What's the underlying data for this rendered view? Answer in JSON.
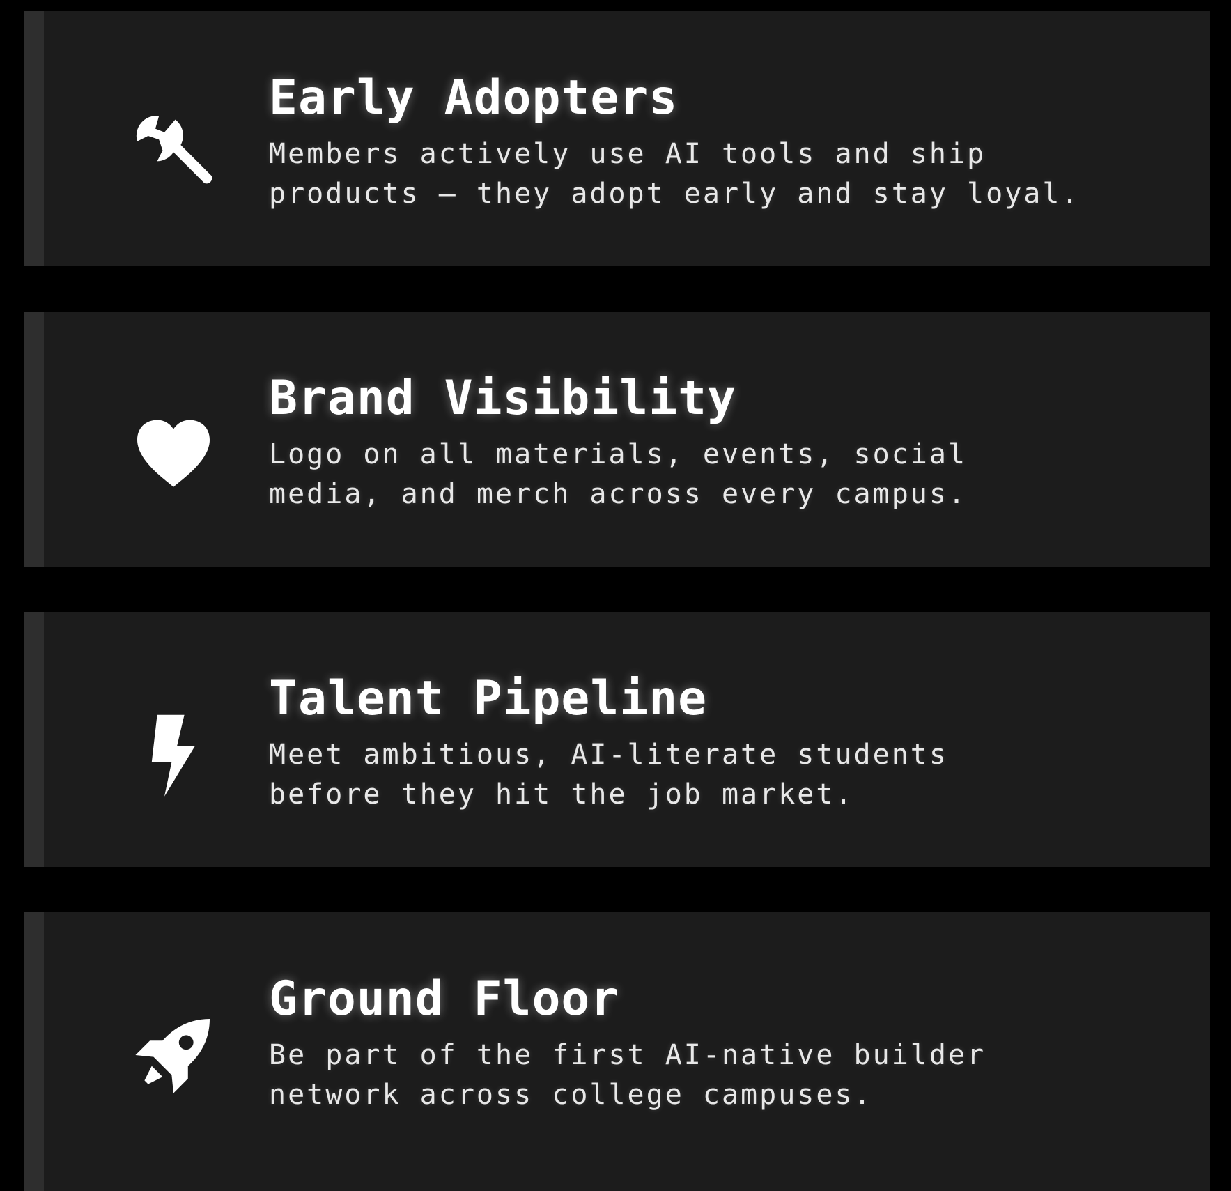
{
  "cards": [
    {
      "icon": "wrench-icon",
      "title": "Early Adopters",
      "description": "Members actively use AI tools and ship\nproducts — they adopt early and stay loyal."
    },
    {
      "icon": "heart-icon",
      "title": "Brand Visibility",
      "description": "Logo on all materials, events, social\nmedia, and merch across every campus."
    },
    {
      "icon": "lightning-bolt-icon",
      "title": "Talent Pipeline",
      "description": "Meet ambitious, AI-literate students\nbefore they hit the job market."
    },
    {
      "icon": "rocket-icon",
      "title": "Ground Floor",
      "description": "Be part of the first AI-native builder\nnetwork across college campuses."
    }
  ],
  "colors": {
    "background": "#000000",
    "card": "#1c1c1c",
    "accent_strip": "#2e2e2e",
    "text": "#ffffff"
  }
}
